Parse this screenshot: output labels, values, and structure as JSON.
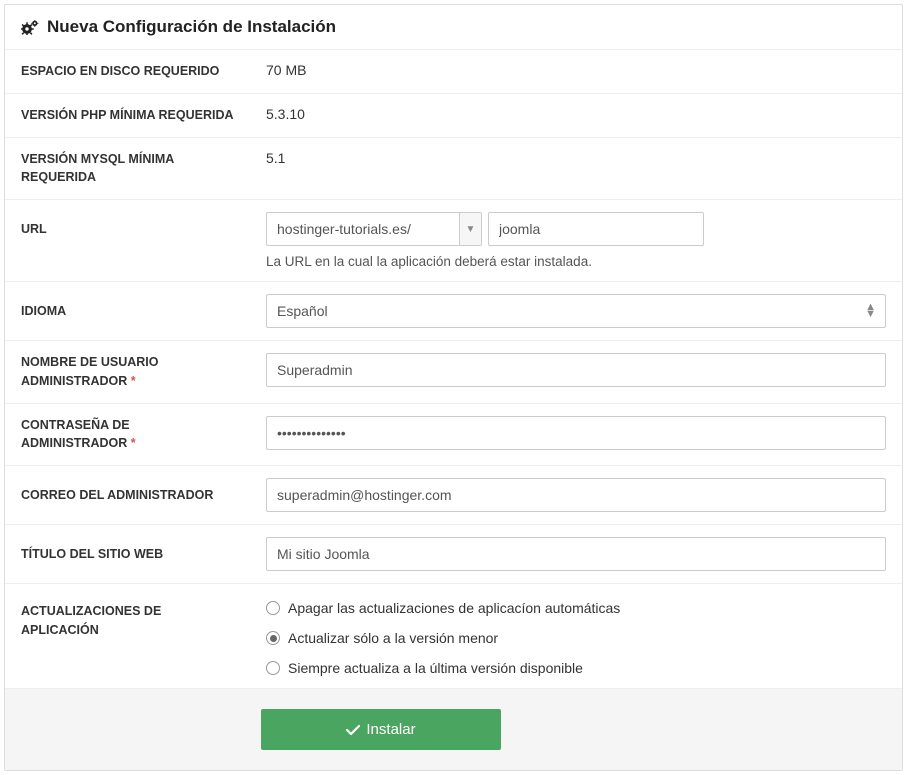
{
  "panel_title": "Nueva Configuración de Instalación",
  "rows": {
    "disk_label": "ESPACIO EN DISCO REQUERIDO",
    "disk_value": "70 MB",
    "php_label": "VERSIÓN PHP MÍNIMA REQUERIDA",
    "php_value": "5.3.10",
    "mysql_label": "VERSIÓN MYSQL MÍNIMA REQUERIDA",
    "mysql_value": "5.1",
    "url_label": "URL",
    "url_domain": "hostinger-tutorials.es/",
    "url_path": "joomla",
    "url_help": "La URL en la cual la aplicación deberá estar instalada.",
    "lang_label": "IDIOMA",
    "lang_value": "Español",
    "admin_user_label": "NOMBRE DE USUARIO ADMINISTRADOR",
    "admin_user_value": "Superadmin",
    "admin_pass_label": "CONTRASEÑA DE ADMINISTRADOR",
    "admin_pass_value": "••••••••••••••",
    "admin_email_label": "CORREO DEL ADMINISTRADOR",
    "admin_email_value": "superadmin@hostinger.com",
    "site_title_label": "TÍTULO DEL SITIO WEB",
    "site_title_value": "Mi sitio Joomla",
    "updates_label": "ACTUALIZACIONES DE APLICACIÓN",
    "updates_options": {
      "off": "Apagar las actualizaciones de aplicacíon automáticas",
      "minor": "Actualizar sólo a la versión menor",
      "latest": "Siempre actualiza a la última versión disponible"
    }
  },
  "install_button": "Instalar"
}
